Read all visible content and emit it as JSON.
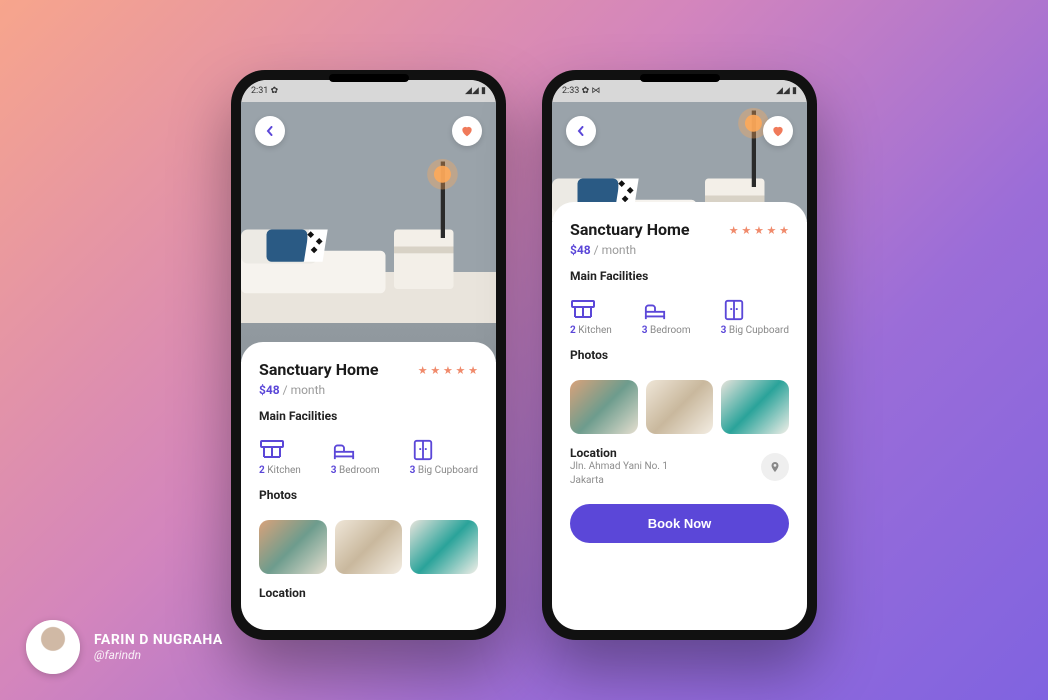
{
  "author": {
    "name": "FARIN D NUGRAHA",
    "handle": "@farindn"
  },
  "statusbar": {
    "time1": "2:31",
    "time2": "2:33",
    "gear": "✿",
    "signal": "▲◢ ▮"
  },
  "listing": {
    "title": "Sanctuary Home",
    "price_amount": "$48",
    "price_period": "/ month",
    "rating_stars": 5,
    "facilities_heading": "Main Facilities",
    "facilities": [
      {
        "count": "2",
        "label": "Kitchen"
      },
      {
        "count": "3",
        "label": "Bedroom"
      },
      {
        "count": "3",
        "label": "Big Cupboard"
      }
    ],
    "photos_heading": "Photos",
    "location_heading": "Location",
    "address_line1": "Jln. Ahmad Yani No. 1",
    "address_line2": "Jakarta",
    "book_label": "Book Now"
  }
}
